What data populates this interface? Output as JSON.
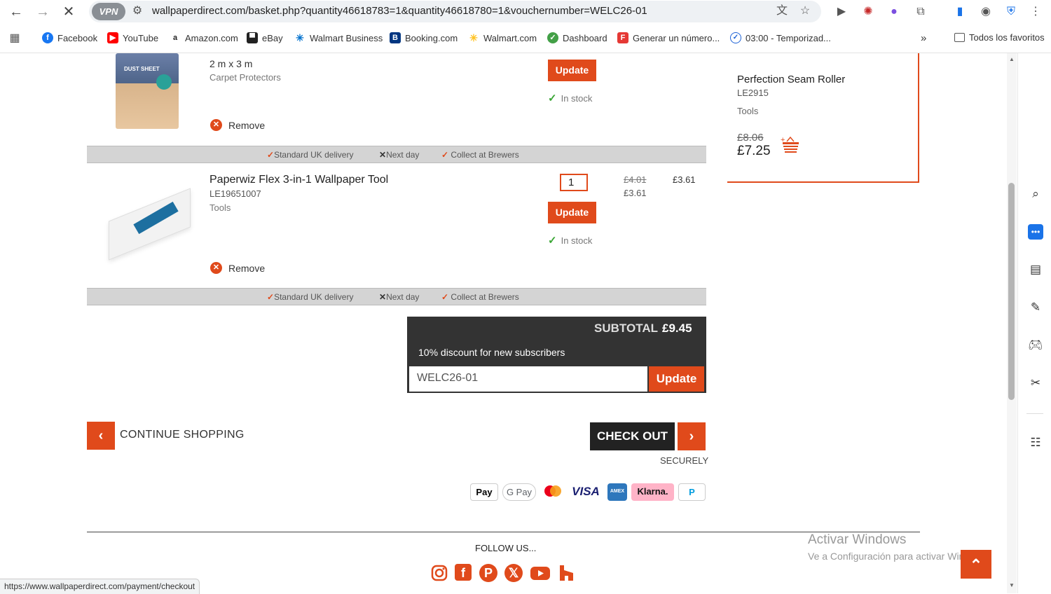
{
  "browser": {
    "vpn_label": "VPN",
    "url": "wallpaperdirect.com/basket.php?quantity46618783=1&quantity46618780=1&vouchernumber=WELC26-01",
    "bookmarks": [
      {
        "label": "Facebook",
        "icon": "facebook-icon",
        "color": "#1877f2"
      },
      {
        "label": "YouTube",
        "icon": "youtube-icon",
        "color": "#ff0000"
      },
      {
        "label": "Amazon.com",
        "icon": "amazon-icon",
        "color": "#222222"
      },
      {
        "label": "eBay",
        "icon": "ebay-icon",
        "color": "#e53238"
      },
      {
        "label": "Walmart Business",
        "icon": "walmart-icon",
        "color": "#0071ce"
      },
      {
        "label": "Booking.com",
        "icon": "booking-icon",
        "color": "#003580"
      },
      {
        "label": "Walmart.com",
        "icon": "walmart-icon",
        "color": "#ffc220"
      },
      {
        "label": "Dashboard",
        "icon": "dashboard-icon",
        "color": "#43a047"
      },
      {
        "label": "Generar un número...",
        "icon": "f-icon",
        "color": "#e53935"
      },
      {
        "label": "03:00 - Temporizad...",
        "icon": "timer-icon",
        "color": "#1e63d6"
      }
    ],
    "all_bookmarks": "Todos los favoritos",
    "status_url": "https://www.wallpaperdirect.com/payment/checkout"
  },
  "basket": {
    "item1": {
      "size": "2 m x 3 m",
      "category": "Carpet Protectors",
      "update_label": "Update",
      "stock": "In stock",
      "remove": "Remove",
      "image_text": "DUST SHEET"
    },
    "item2": {
      "name": "Paperwiz Flex 3-in-1 Wallpaper Tool",
      "sku": "LE19651007",
      "category": "Tools",
      "quantity": "1",
      "price_old": "£4.01",
      "price_current": "£3.61",
      "line_total": "£3.61",
      "update_label": "Update",
      "stock": "In stock",
      "remove": "Remove"
    },
    "delivery": {
      "standard": "Standard UK delivery",
      "next_day": "Next day",
      "collect": "Collect at Brewers"
    }
  },
  "side_product": {
    "name": "Perfection Seam Roller",
    "sku": "LE2915",
    "category": "Tools",
    "price_old": "£8.06",
    "price": "£7.25",
    "add_icon": "add-to-basket-icon"
  },
  "summary": {
    "subtotal_label": "SUBTOTAL",
    "subtotal_value": "£9.45",
    "discount_note": "10% discount for new subscribers",
    "voucher_code": "WELC26-01",
    "voucher_update": "Update"
  },
  "actions": {
    "continue_shopping": "CONTINUE SHOPPING",
    "checkout": "CHECK OUT",
    "securely": "SECURELY"
  },
  "payments": [
    "Pay",
    "G Pay",
    "mastercard",
    "VISA",
    "AMEX",
    "Klarna.",
    "PayPal"
  ],
  "footer": {
    "follow": "FOLLOW US...",
    "social": [
      "instagram-icon",
      "facebook-icon",
      "pinterest-icon",
      "x-icon",
      "youtube-icon",
      "houzz-icon"
    ]
  },
  "windows": {
    "activate_title": "Activar Windows",
    "activate_sub": "Ve a Configuración para activar Windows."
  },
  "colors": {
    "accent": "#e04a1b",
    "dark": "#333333",
    "stock_green": "#3aa635"
  }
}
